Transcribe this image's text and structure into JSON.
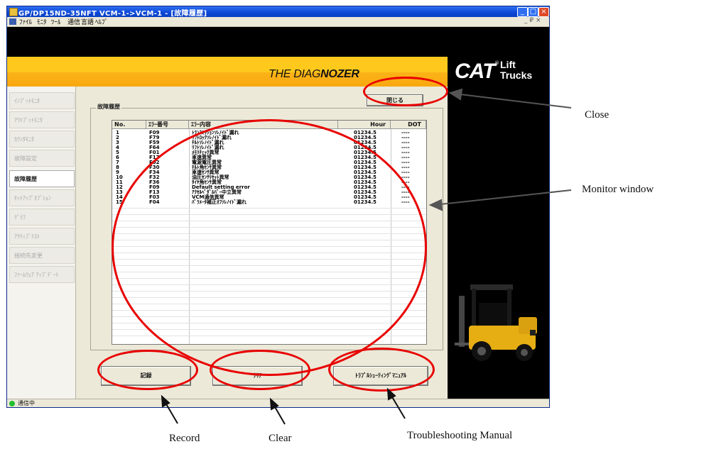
{
  "window": {
    "title": "GP/DP15ND-35NFT VCM-1->VCM-1 - [故障履歴]",
    "menu": [
      "ﾌｧｲﾙ",
      "ﾓﾆﾀ",
      "ﾂｰﾙ",
      "通信",
      "言語",
      "ﾍﾙﾌﾟ"
    ],
    "mdi_controls": "_ ₽ ×"
  },
  "banner": {
    "diag_prefix": "THE DIAG",
    "diag_suffix": "NOZER",
    "brand": "CAT",
    "brand_sub_1": "Lift",
    "brand_sub_2": "Trucks",
    "reg": "®"
  },
  "sidebar": {
    "items": [
      {
        "label": "ｲﾝﾌﾟｯﾄﾓﾆﾀ",
        "active": false
      },
      {
        "label": "ｱｳﾄﾌﾟｯﾄﾓﾆﾀ",
        "active": false
      },
      {
        "label": "ｶｳﾝﾀﾓﾆﾀ",
        "active": false
      },
      {
        "label": "故障設定",
        "active": false
      },
      {
        "label": "故障履歴",
        "active": true
      },
      {
        "label": "ｾｯﾄｱｯﾌﾟｵﾌﾟｼｮﾝ",
        "active": false
      },
      {
        "label": "ｸﾞﾗﾌ",
        "active": false
      },
      {
        "label": "ｱｸﾃｨﾌﾞﾃｽﾄ",
        "active": false
      },
      {
        "label": "接続先変更",
        "active": false
      },
      {
        "label": "ﾌｧｰﾑｳｪｱ ｱｯﾌﾟﾃﾞｰﾄ",
        "active": false
      }
    ]
  },
  "main": {
    "frame_label": "故障履歴",
    "close_button": "閉じる",
    "columns": {
      "no": "No.",
      "code": "ｴﾗｰ番号",
      "desc": "ｴﾗｰ内容",
      "hour": "Hour",
      "dot": "DOT"
    },
    "rows": [
      {
        "no": "1",
        "code": "F09",
        "desc": "ﾄﾗﾝｽﾐｯｼｮﾝｿﾚﾉｲﾄﾞ漏れ",
        "hour": "01234.5",
        "dot": "----"
      },
      {
        "no": "2",
        "code": "F79",
        "desc": "ﾘﾌﾄﾛｯｸｿﾚﾉｲﾄﾞ漏れ",
        "hour": "01234.5",
        "dot": "----"
      },
      {
        "no": "3",
        "code": "F59",
        "desc": "ﾁﾙﾄｿﾚﾉｲﾄﾞ漏れ",
        "hour": "01234.5",
        "dot": "----"
      },
      {
        "no": "4",
        "code": "F64",
        "desc": "ﾘﾌﾄｿﾚﾉｲﾄﾞ漏れ",
        "hour": "01234.5",
        "dot": "----"
      },
      {
        "no": "5",
        "code": "F01",
        "desc": "ﾒﾓﾘﾁｪｯｸ異常",
        "hour": "01234.5",
        "dot": "----"
      },
      {
        "no": "6",
        "code": "F17",
        "desc": "車速異常",
        "hour": "01234.5",
        "dot": "----"
      },
      {
        "no": "7",
        "code": "F02",
        "desc": "電源電圧異常",
        "hour": "01234.5",
        "dot": "----"
      },
      {
        "no": "8",
        "code": "F30",
        "desc": "ﾁﾙﾄ角ｾﾝｻ異常",
        "hour": "01234.5",
        "dot": "----"
      },
      {
        "no": "9",
        "code": "F34",
        "desc": "車速ｾﾝｻ異常",
        "hour": "01234.5",
        "dot": "----"
      },
      {
        "no": "10",
        "code": "F32",
        "desc": "油圧ｾﾝｻﾘｾｯﾄ異常",
        "hour": "01234.5",
        "dot": "----"
      },
      {
        "no": "11",
        "code": "F36",
        "desc": "ﾀｲﾔ角ｾﾝｻ異常",
        "hour": "01234.5",
        "dot": "----"
      },
      {
        "no": "12",
        "code": "F09",
        "desc": "Default setting error",
        "hour": "01234.5",
        "dot": "----"
      },
      {
        "no": "13",
        "code": "F13",
        "desc": "ｱｸｾﾙﾍﾟﾀﾞﾙﾊﾞｰ中立異常",
        "hour": "01234.5",
        "dot": "----"
      },
      {
        "no": "14",
        "code": "F03",
        "desc": "VCM通信異常",
        "hour": "01234.5",
        "dot": "----"
      },
      {
        "no": "15",
        "code": "F04",
        "desc": "ﾊﾟﾗﾒｰﾀ補正ｵﾌｿﾚﾉｲﾄﾞ漏れ",
        "hour": "01234.5",
        "dot": "----"
      }
    ],
    "record_button": "記録",
    "clear_button": "ｸﾘｱ",
    "manual_button": "ﾄﾗﾌﾞﾙｼｭｰﾃｨﾝｸﾞﾏﾆｭｱﾙ"
  },
  "status": {
    "text": "通信中"
  },
  "callouts": {
    "close": "Close",
    "monitor": "Monitor window",
    "record": "Record",
    "clear": "Clear",
    "manual": "Troubleshooting Manual"
  },
  "colors": {
    "annotation": "#e80000",
    "banner": "#ffc020",
    "titlebar": "#0b47d6"
  }
}
